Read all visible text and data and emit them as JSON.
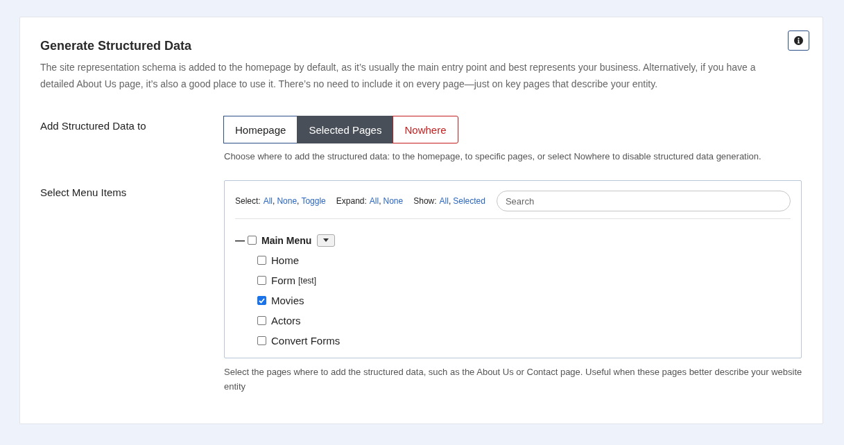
{
  "panel": {
    "title": "Generate Structured Data",
    "description": "The site representation schema is added to the homepage by default, as it’s usually the main entry point and best represents your business. Alternatively, if you have a detailed About Us page, it’s also a good place to use it. There’s no need to include it on every page—just on key pages that describe your entity."
  },
  "placement": {
    "label": "Add Structured Data to",
    "options": [
      {
        "label": "Homepage",
        "selected": false,
        "kind": "default"
      },
      {
        "label": "Selected Pages",
        "selected": true,
        "kind": "default"
      },
      {
        "label": "Nowhere",
        "selected": false,
        "kind": "danger"
      }
    ],
    "help": "Choose where to add the structured data: to the homepage, to specific pages, or select Nowhere to disable structured data generation."
  },
  "menu_items": {
    "label": "Select Menu Items",
    "toolbar": [
      {
        "label": "Select:",
        "separator": ",",
        "links": [
          "All",
          "None",
          "Toggle"
        ]
      },
      {
        "label": "Expand:",
        "separator": ",",
        "links": [
          "All",
          "None"
        ]
      },
      {
        "label": "Show:",
        "separator": ",",
        "links": [
          "All",
          "Selected"
        ]
      }
    ],
    "search": {
      "placeholder": "Search"
    },
    "tree": [
      {
        "label": "Main Menu",
        "checked": false,
        "expanded": true,
        "toggle": "—",
        "children": [
          {
            "label": "Home",
            "checked": false
          },
          {
            "label": "Form",
            "note": "[test]",
            "checked": false
          },
          {
            "label": "Movies",
            "checked": true
          },
          {
            "label": "Actors",
            "checked": false
          },
          {
            "label": "Convert Forms",
            "checked": false
          }
        ]
      }
    ],
    "help": "Select the pages where to add the structured data, such as the About Us or Contact page. Useful when these pages better describe your website entity"
  }
}
